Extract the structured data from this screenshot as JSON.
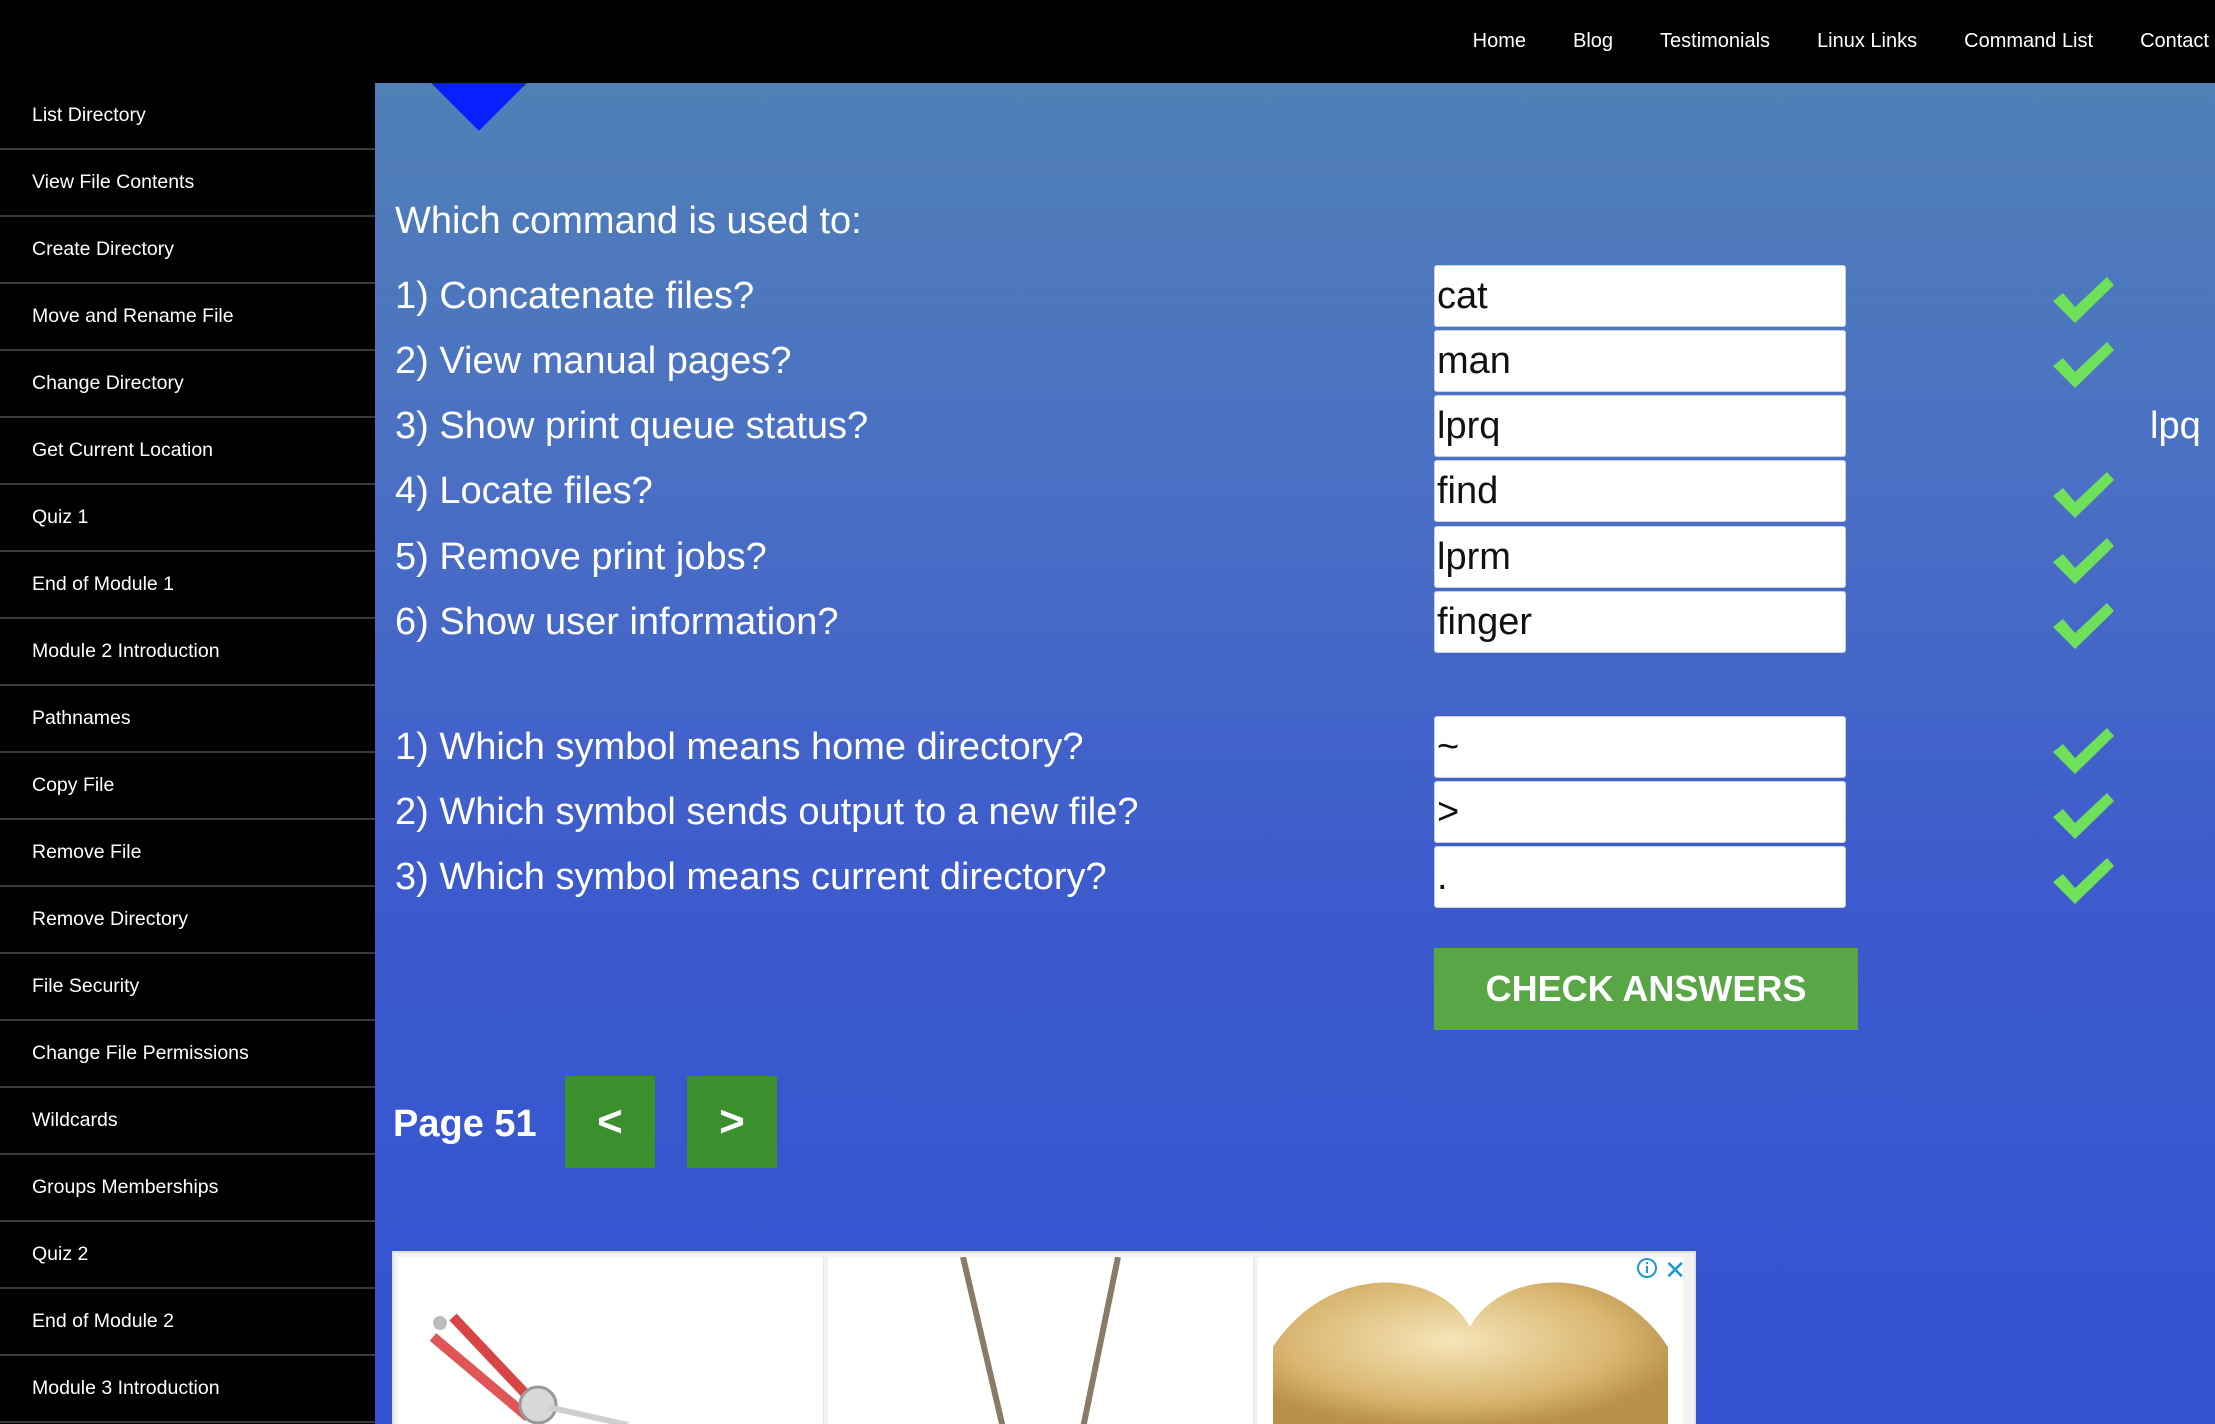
{
  "topnav": {
    "items": [
      "Home",
      "Blog",
      "Testimonials",
      "Linux Links",
      "Command List",
      "Contact"
    ]
  },
  "sidebar": {
    "items": [
      "List Directory",
      "View File Contents",
      "Create Directory",
      "Move and Rename File",
      "Change Directory",
      "Get Current Location",
      "Quiz 1",
      "End of Module 1",
      "Module 2 Introduction",
      "Pathnames",
      "Copy File",
      "Remove File",
      "Remove Directory",
      "File Security",
      "Change File Permissions",
      "Wildcards",
      "Groups Memberships",
      "Quiz 2",
      "End of Module 2",
      "Module 3 Introduction"
    ]
  },
  "quiz": {
    "heading": "Which command is used to:",
    "commands": [
      {
        "question": "1) Concatenate files?",
        "answer": "cat",
        "correct": true,
        "correction": ""
      },
      {
        "question": "2) View manual pages?",
        "answer": "man",
        "correct": true,
        "correction": ""
      },
      {
        "question": "3) Show print queue status?",
        "answer": "lprq",
        "correct": false,
        "correction": "lpq"
      },
      {
        "question": "4) Locate files?",
        "answer": "find",
        "correct": true,
        "correction": ""
      },
      {
        "question": "5) Remove print jobs?",
        "answer": "lprm",
        "correct": true,
        "correction": ""
      },
      {
        "question": "6) Show user information?",
        "answer": "finger",
        "correct": true,
        "correction": ""
      }
    ],
    "symbols": [
      {
        "question": "1) Which symbol means home directory?",
        "answer": "~",
        "correct": true,
        "correction": ""
      },
      {
        "question": "2) Which symbol sends output to a new file?",
        "answer": ">",
        "correct": true,
        "correction": ""
      },
      {
        "question": "3) Which symbol means current directory?",
        "answer": ".",
        "correct": true,
        "correction": ""
      }
    ],
    "check_button": "CHECK ANSWERS"
  },
  "pager": {
    "label": "Page 51",
    "prev": "<",
    "next": ">"
  },
  "ad": {
    "close": "✕",
    "info": "i"
  },
  "colors": {
    "check_green": "#6ee05a",
    "button_green": "#58a646",
    "nav_green": "#3b8f2c",
    "logo_blue": "#0a1fff"
  }
}
